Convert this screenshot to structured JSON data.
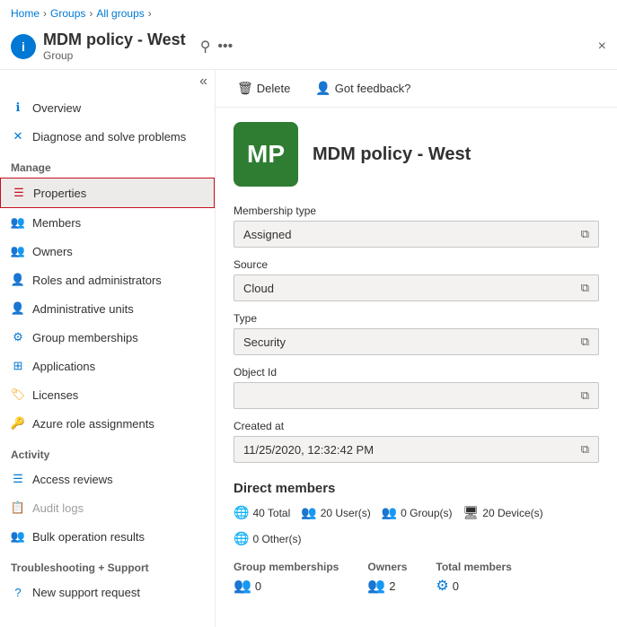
{
  "breadcrumb": {
    "items": [
      "Home",
      "Groups",
      "All groups"
    ]
  },
  "titlebar": {
    "icon": "i",
    "title": "MDM policy - West",
    "subtitle": "Group",
    "pin_label": "📌",
    "more_label": "•••",
    "close_label": "×"
  },
  "toolbar": {
    "delete_label": "Delete",
    "feedback_label": "Got feedback?"
  },
  "sidebar": {
    "collapse_icon": "«",
    "overview_label": "Overview",
    "diagnose_label": "Diagnose and solve problems",
    "manage_label": "Manage",
    "properties_label": "Properties",
    "members_label": "Members",
    "owners_label": "Owners",
    "roles_label": "Roles and administrators",
    "admin_units_label": "Administrative units",
    "group_memberships_label": "Group memberships",
    "applications_label": "Applications",
    "licenses_label": "Licenses",
    "azure_role_label": "Azure role assignments",
    "activity_label": "Activity",
    "access_reviews_label": "Access reviews",
    "audit_logs_label": "Audit logs",
    "bulk_ops_label": "Bulk operation results",
    "troubleshooting_label": "Troubleshooting + Support",
    "new_support_label": "New support request"
  },
  "group": {
    "initials": "MP",
    "name": "MDM policy - West",
    "fields": {
      "membership_type_label": "Membership type",
      "membership_type_value": "Assigned",
      "source_label": "Source",
      "source_value": "Cloud",
      "type_label": "Type",
      "type_value": "Security",
      "object_id_label": "Object Id",
      "object_id_value": "",
      "created_at_label": "Created at",
      "created_at_value": "11/25/2020, 12:32:42 PM"
    },
    "direct_members": {
      "title": "Direct members",
      "total_label": "40 Total",
      "users_label": "20 User(s)",
      "groups_label": "0 Group(s)",
      "devices_label": "20 Device(s)",
      "others_label": "0 Other(s)"
    },
    "stats": [
      {
        "label": "Group memberships",
        "value": "0"
      },
      {
        "label": "Owners",
        "value": "2"
      },
      {
        "label": "Total members",
        "value": "0"
      }
    ]
  }
}
